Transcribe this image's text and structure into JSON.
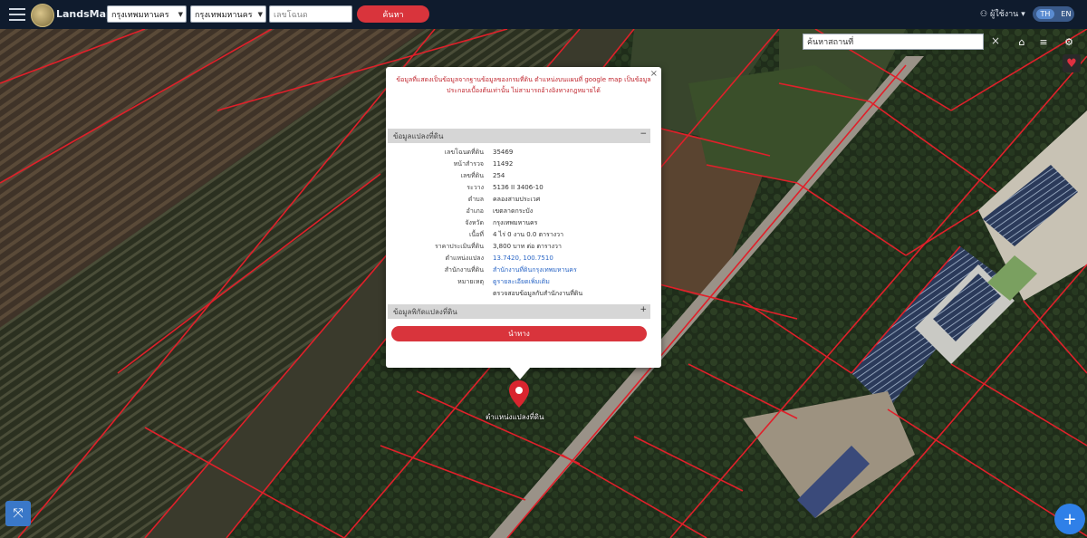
{
  "header": {
    "brand": "LandsMaps",
    "province_select": "กรุงเทพมหานคร",
    "district_select": "กรุงเทพมหานคร",
    "parcel_placeholder": "เลขโฉนด",
    "search_label": "ค้นหา",
    "user_label": "ผู้ใช้งาน",
    "lang_th": "TH",
    "lang_en": "EN"
  },
  "map": {
    "search_value": "ค้นหาสถานที่",
    "pin_label": "ตำแหน่งแปลงที่ดิน"
  },
  "popup": {
    "notice": "ข้อมูลที่แสดงเป็นข้อมูลจากฐานข้อมูลของกรมที่ดิน ตำแหน่งบนแผนที่ google map เป็นข้อมูลประกอบเบื้องต้นเท่านั้น ไม่สามารถอ้างอิงทางกฎหมายได้",
    "section1": "ข้อมูลแปลงที่ดิน",
    "section1_toggle": "−",
    "rows": [
      {
        "k": "เลขโฉนดที่ดิน",
        "v": "35469"
      },
      {
        "k": "หน้าสำรวจ",
        "v": "11492"
      },
      {
        "k": "เลขที่ดิน",
        "v": "254"
      },
      {
        "k": "ระวาง",
        "v": "5136 II 3406-10"
      },
      {
        "k": "ตำบล",
        "v": "คลองสามประเวศ"
      },
      {
        "k": "อำเภอ",
        "v": "เขตลาดกระบัง"
      },
      {
        "k": "จังหวัด",
        "v": "กรุงเทพมหานคร"
      },
      {
        "k": "เนื้อที่",
        "v": "4 ไร่ 0 งาน 0.0 ตารางวา"
      },
      {
        "k": "ราคาประเมินที่ดิน",
        "v": "3,800 บาท ต่อ ตารางวา"
      },
      {
        "k": "ตำแหน่งแปลง",
        "v": "13.7420, 100.7510"
      },
      {
        "k": "สำนักงานที่ดิน",
        "v": "สำนักงานที่ดินกรุงเทพมหานคร"
      },
      {
        "k": "หมายเหตุ",
        "v": "ดูรายละเอียดเพิ่มเติม"
      },
      {
        "k": "",
        "v": "ตรวจสอบข้อมูลกับสำนักงานที่ดิน"
      }
    ],
    "section2": "ข้อมูลพิกัดแปลงที่ดิน",
    "section2_toggle": "+",
    "nav_button": "นำทาง"
  },
  "icons": {
    "hamburger": "menu-icon",
    "logo": "logo-icon",
    "search_close": "×",
    "home": "⌂",
    "layers": "≡",
    "heart": "♥",
    "fab": "+",
    "fullscreen": "⤧"
  }
}
